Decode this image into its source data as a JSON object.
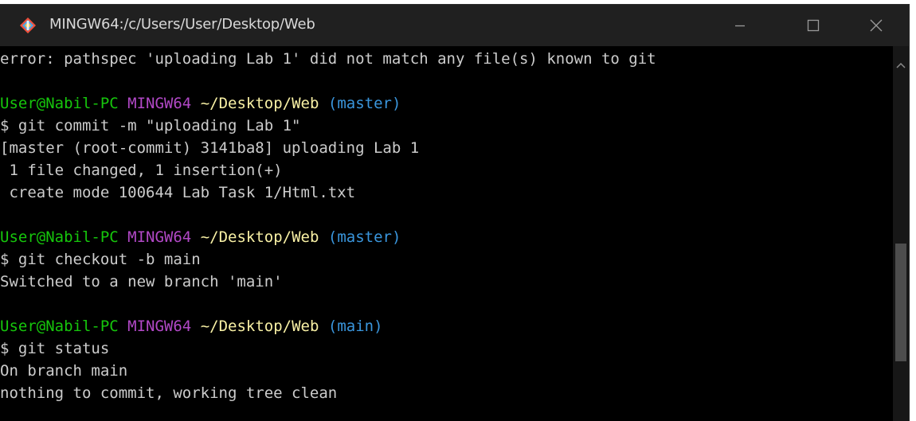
{
  "window": {
    "title": "MINGW64:/c/Users/User/Desktop/Web",
    "icon": "git-bash-icon",
    "controls": {
      "minimize": "minimize-icon",
      "maximize": "maximize-icon",
      "close": "close-icon"
    }
  },
  "colors": {
    "user_host": "#16c60c",
    "mingw": "#b148c6",
    "path": "#f9f1a5",
    "branch": "#3a96dd",
    "text": "#cccccc",
    "background": "#000000",
    "titlebar": "#202020"
  },
  "terminal": {
    "lines": {
      "error": "error: pathspec 'uploading Lab 1' did not match any file(s) known to git",
      "prompt1": {
        "user": "User@Nabil-PC",
        "mingw": "MINGW64",
        "path": "~/Desktop/Web",
        "branch": "(master)"
      },
      "cmd1": "$ git commit -m \"uploading Lab 1\"",
      "out1a": "[master (root-commit) 3141ba8] uploading Lab 1",
      "out1b": " 1 file changed, 1 insertion(+)",
      "out1c": " create mode 100644 Lab Task 1/Html.txt",
      "prompt2": {
        "user": "User@Nabil-PC",
        "mingw": "MINGW64",
        "path": "~/Desktop/Web",
        "branch": "(master)"
      },
      "cmd2": "$ git checkout -b main",
      "out2": "Switched to a new branch 'main'",
      "prompt3": {
        "user": "User@Nabil-PC",
        "mingw": "MINGW64",
        "path": "~/Desktop/Web",
        "branch": "(main)"
      },
      "cmd3": "$ git status",
      "out3a": "On branch main",
      "out3b": "nothing to commit, working tree clean"
    }
  },
  "scrollbar": {
    "up_icon": "chevron-up-icon"
  }
}
